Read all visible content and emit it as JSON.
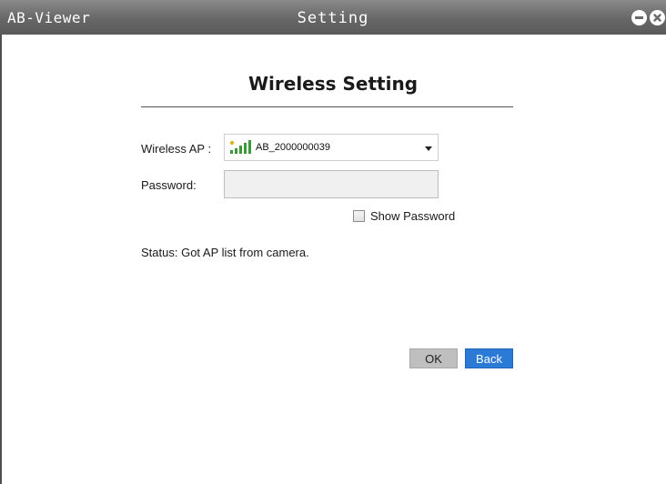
{
  "window": {
    "app_name": "AB-Viewer",
    "title": "Setting",
    "minimize_icon": "minimize-icon",
    "close_icon": "close-icon"
  },
  "form": {
    "heading": "Wireless Setting",
    "wireless_ap_label": "Wireless AP :",
    "wireless_ap_value": "AB_2000000039",
    "wireless_ap_icon": "wifi-signal-icon",
    "password_label": "Password:",
    "password_value": "",
    "show_password_label": "Show Password",
    "show_password_checked": false
  },
  "status": {
    "text": "Status: Got AP list from camera."
  },
  "buttons": {
    "ok_label": "OK",
    "back_label": "Back"
  },
  "colors": {
    "titlebar": "#676767",
    "back_button": "#2a7ad6",
    "ok_button": "#bfbfbf"
  }
}
